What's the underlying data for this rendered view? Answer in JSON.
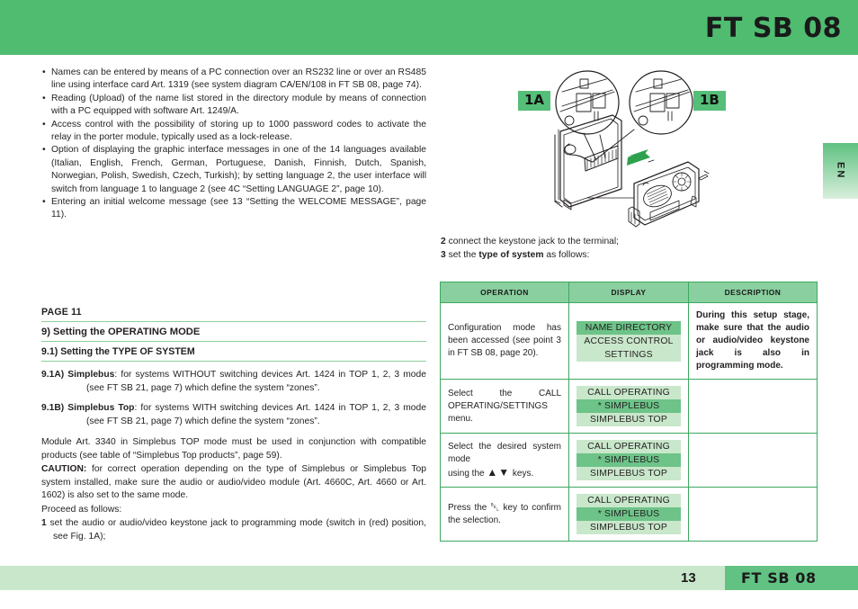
{
  "header": {
    "title": "FT SB 08",
    "bar_color": "#4FBC70"
  },
  "side_tab": {
    "label": "EN"
  },
  "left_column": {
    "bullets": [
      "Names can be entered by means of a PC connection over an RS232 line or over an RS485 line using interface card Art. 1319 (see system diagram CA/EN/108 in FT SB 08, page 74).",
      "Reading (Upload) of the name list stored in the directory module by means of connection with a PC equipped with software Art. 1249/A.",
      "Access control with the possibility of storing up to 1000 password codes to activate the relay in the porter module, typically used as a lock-release.",
      "Option of displaying the graphic interface messages in one of the 14 languages available (Italian, English, French, German, Portuguese, Danish, Finnish, Dutch, Spanish, Norwegian, Polish, Swedish, Czech, Turkish); by setting language 2, the user interface will switch from language 1 to language 2 (see 4C “Setting LANGUAGE 2”, page 10).",
      "Entering an initial welcome message (see 13 “Setting the WELCOME MESSAGE”, page 11)."
    ],
    "page_label": "PAGE 11",
    "section_heading": "9) Setting the OPERATING MODE",
    "subsection_heading": "9.1) Setting the TYPE OF SYSTEM",
    "item_a": {
      "number": "9.1A)",
      "term": "Simplebus",
      "text": ": for systems WITHOUT switching devices Art. 1424 in TOP 1, 2, 3 mode (see FT SB 21, page 7) which define the system “zones”."
    },
    "item_b": {
      "number": "9.1B)",
      "term": "Simplebus Top",
      "text": ": for systems WITH switching devices Art. 1424 in TOP 1, 2, 3 mode (see FT SB 21, page 7) which define the system “zones”."
    },
    "module_note": "Module Art. 3340 in Simplebus TOP mode must be used in conjunction with compatible products (see table of “Simplebus Top products”, page 59).",
    "caution_label": "CAUTION:",
    "caution_text": " for correct operation depending on the type of Simplebus or Simplebus Top system installed, make sure the audio or audio/video module (Art. 4660C, Art. 4660 or Art. 1602) is also set to the same mode.",
    "proceed_label": "Proceed as follows:",
    "step_1_number": "1",
    "step_1_text": " set the audio or audio/video keystone jack to programming mode (switch in (red) position, see Fig. 1A);"
  },
  "figure": {
    "tag_1a": "1A",
    "tag_1b": "1B",
    "tag_color": "#55BE78"
  },
  "right_column": {
    "step_2_number": "2",
    "step_2_text": " connect the keystone jack to the terminal;",
    "step_3_number": "3",
    "step_3_prefix": " set the ",
    "step_3_bold": "type of system",
    "step_3_suffix": " as follows:"
  },
  "table": {
    "headers": [
      "OPERATION",
      "DISPLAY",
      "DESCRIPTION"
    ],
    "header_bg": "#8ACF9F",
    "border_color": "#3EA85F",
    "lcd_bg": "#C9E7CB",
    "lcd_selected_bg": "#6DC388",
    "rows": [
      {
        "operation": "Configuration mode has been accessed (see point 3 in FT SB 08, page 20).",
        "display_lines": [
          "NAME DIRECTORY",
          "ACCESS CONTROL",
          "SETTINGS"
        ],
        "display_selected_index": 0,
        "description": "During this setup stage, make sure that the audio or audio/video keystone jack is also in programming mode."
      },
      {
        "operation": "Select the CALL OPERATING/SETTINGS menu.",
        "display_lines": [
          "CALL OPERATING",
          "* SIMPLEBUS",
          "SIMPLEBUS TOP"
        ],
        "display_selected_index": 1,
        "description": ""
      },
      {
        "operation_line1": "Select the desired system mode",
        "operation_line2_prefix": "using the ",
        "operation_line2_icon": "▲▼",
        "operation_line2_suffix": " keys.",
        "display_lines": [
          "CALL OPERATING",
          "* SIMPLEBUS",
          "SIMPLEBUS TOP"
        ],
        "display_selected_index": 1,
        "description": ""
      },
      {
        "operation_prefix": "Press the ",
        "operation_icon": "␇",
        "operation_suffix": " key to confirm the selection.",
        "display_lines": [
          "CALL OPERATING",
          "* SIMPLEBUS",
          "SIMPLEBUS TOP"
        ],
        "display_selected_index": 1,
        "description": ""
      }
    ]
  },
  "footer": {
    "page_number": "13",
    "title": "FT SB 08",
    "band_color": "#C9E7CB",
    "right_color": "#62C283"
  }
}
